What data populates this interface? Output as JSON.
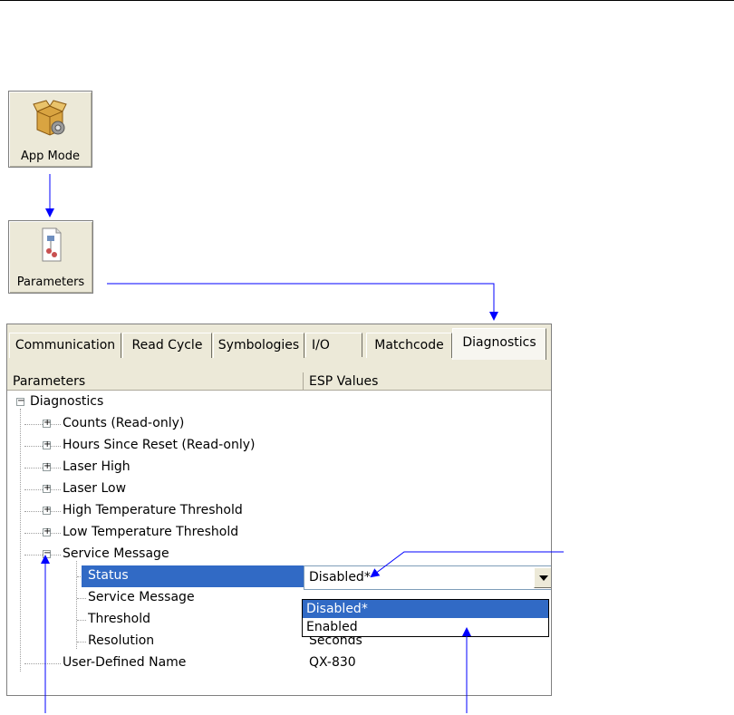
{
  "toolbar": {
    "app_mode_label": "App Mode",
    "parameters_label": "Parameters"
  },
  "tabs": [
    {
      "label": "Communication"
    },
    {
      "label": "Read Cycle"
    },
    {
      "label": "Symbologies"
    },
    {
      "label": "I/O"
    },
    {
      "label": "Matchcode"
    },
    {
      "label": "Diagnostics",
      "active": true
    }
  ],
  "columns": {
    "parameters": "Parameters",
    "esp_values": "ESP Values"
  },
  "tree": {
    "root": "Diagnostics",
    "items": [
      "Counts (Read-only)",
      "Hours Since Reset (Read-only)",
      "Laser High",
      "Laser Low",
      "High Temperature Threshold",
      "Low Temperature Threshold",
      "Service Message"
    ],
    "service_children": [
      {
        "label": "Status",
        "value": "Disabled*"
      },
      {
        "label": "Service Message",
        "value": ""
      },
      {
        "label": "Threshold",
        "value": ""
      },
      {
        "label": "Resolution",
        "value": "Seconds"
      }
    ],
    "user_defined": {
      "label": "User-Defined Name",
      "value": "QX-830"
    }
  },
  "dropdown": {
    "selected": "Disabled*",
    "options": [
      "Disabled*",
      "Enabled"
    ]
  },
  "colors": {
    "selection": "#316ac5",
    "arrow": "#0000ff",
    "tab_bg": "#ece9d8"
  }
}
